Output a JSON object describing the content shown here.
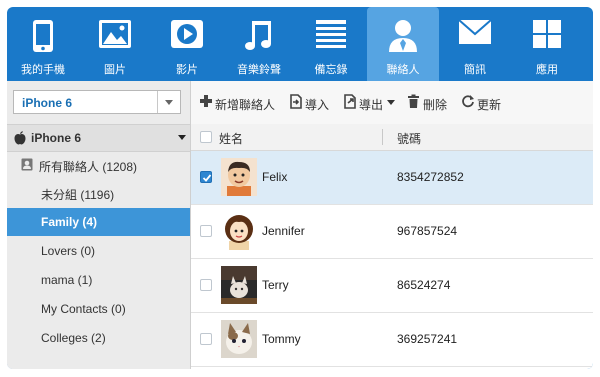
{
  "nav": {
    "tabs": [
      {
        "label": "我的手機",
        "icon": "phone-icon"
      },
      {
        "label": "圖片",
        "icon": "picture-icon"
      },
      {
        "label": "影片",
        "icon": "video-icon"
      },
      {
        "label": "音樂鈴聲",
        "icon": "music-icon"
      },
      {
        "label": "備忘錄",
        "icon": "notes-icon"
      },
      {
        "label": "聯絡人",
        "icon": "contacts-icon",
        "active": true
      },
      {
        "label": "簡訊",
        "icon": "message-icon"
      },
      {
        "label": "應用",
        "icon": "apps-icon"
      }
    ]
  },
  "sidebar": {
    "device_select": "iPhone 6",
    "device_header": "iPhone 6",
    "groups": [
      {
        "label": "所有聯絡人 (1208)"
      },
      {
        "label": "未分組 (1196)"
      },
      {
        "label": "Family (4)",
        "active": true
      },
      {
        "label": "Lovers (0)"
      },
      {
        "label": "mama (1)"
      },
      {
        "label": "My Contacts (0)"
      },
      {
        "label": "Colleges (2)"
      }
    ]
  },
  "toolbar": {
    "add": "新增聯絡人",
    "import": "導入",
    "export": "導出",
    "delete": "刪除",
    "refresh": "更新"
  },
  "table": {
    "col_name": "姓名",
    "col_phone": "號碼",
    "rows": [
      {
        "name": "Felix",
        "phone": "8354272852",
        "checked": true
      },
      {
        "name": "Jennifer",
        "phone": "967857524",
        "checked": false
      },
      {
        "name": "Terry",
        "phone": "86524274",
        "checked": false
      },
      {
        "name": "Tommy",
        "phone": "369257241",
        "checked": false
      }
    ]
  },
  "colors": {
    "nav_blue": "#1a79c9",
    "active_tab": "#56a4e2",
    "active_group": "#3d95d8",
    "selected_row": "#dcebf7"
  }
}
